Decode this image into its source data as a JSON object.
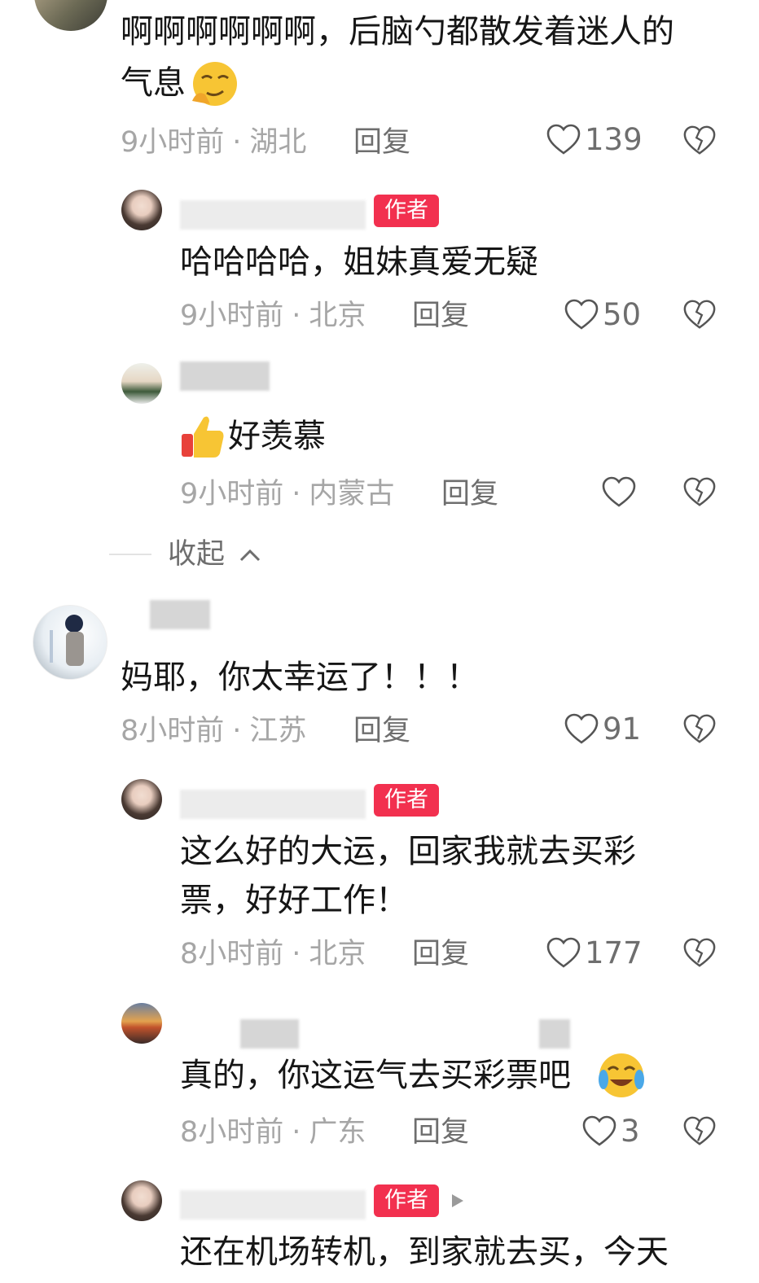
{
  "comments": [
    {
      "text_line1": "啊啊啊啊啊啊，后脑勺都散发着迷人的",
      "text_line2": "气息",
      "emoji": "smirk-emoji",
      "time": "9小时前",
      "location": "湖北",
      "reply_label": "回复",
      "likes": "139"
    },
    {
      "badge": "作者",
      "text": "哈哈哈哈，姐妹真爱无疑",
      "time": "9小时前",
      "location": "北京",
      "reply_label": "回复",
      "likes": "50"
    },
    {
      "emoji": "thumbs-up-emoji",
      "text": "好羡慕",
      "time": "9小时前",
      "location": "内蒙古",
      "reply_label": "回复",
      "likes": ""
    },
    {
      "text": "妈耶，你太幸运了！！！",
      "time": "8小时前",
      "location": "江苏",
      "reply_label": "回复",
      "likes": "91"
    },
    {
      "badge": "作者",
      "text_line1": "这么好的大运，回家我就去买彩",
      "text_line2": "票，好好工作！",
      "time": "8小时前",
      "location": "北京",
      "reply_label": "回复",
      "likes": "177"
    },
    {
      "text": "真的，你这运气去买彩票吧",
      "emoji": "crying-laughing-emoji",
      "time": "8小时前",
      "location": "广东",
      "reply_label": "回复",
      "likes": "3"
    },
    {
      "badge": "作者",
      "text": "还在机场转机，到家就去买，今天"
    }
  ],
  "collapse_label": "收起",
  "colors": {
    "author_badge": "#f2304f",
    "meta": "#a6a6a6",
    "text": "#161616"
  }
}
